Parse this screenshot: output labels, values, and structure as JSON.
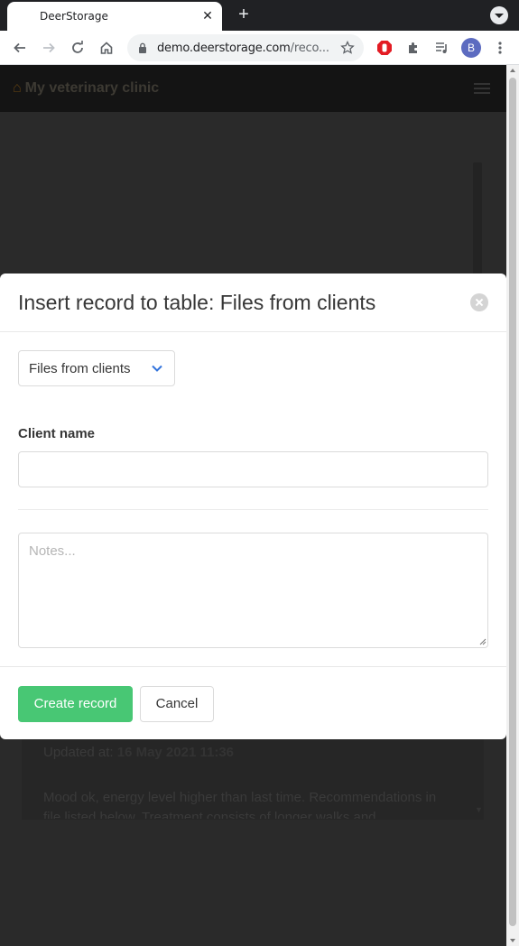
{
  "browser": {
    "tab_title": "DeerStorage",
    "tab_close": "✕",
    "new_tab": "+",
    "url_host": "demo.deerstorage.com",
    "url_rest": "/reco...",
    "profile_initial": "B"
  },
  "app": {
    "brand": "My veterinary clinic",
    "updated_label": "Updated at:",
    "updated_value": "16 May 2021 11:36",
    "notes_preview": "Mood ok, energy level higher than last time. Recommendations in file listed below. Treatment consists of longer walks and"
  },
  "modal": {
    "title": "Insert record to table: Files from clients",
    "table_selector": "Files from clients",
    "client_name_label": "Client name",
    "client_name_value": "",
    "notes_placeholder": "Notes...",
    "create_label": "Create record",
    "cancel_label": "Cancel"
  },
  "colors": {
    "primary": "#48c774",
    "link": "#3273dc"
  }
}
